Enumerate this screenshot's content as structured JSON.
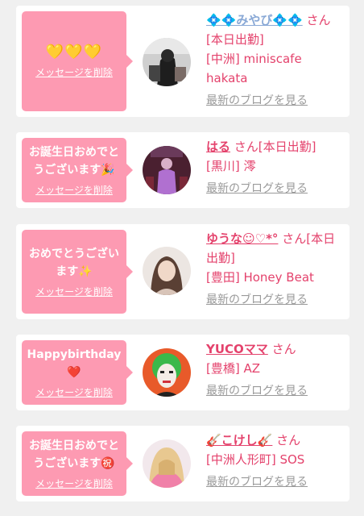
{
  "delete_label": "メッセージを削除",
  "blog_label": "最新のブログを見る",
  "san_suffix": "さん[本日出勤]",
  "san_only": "さん",
  "cards": [
    {
      "message": "💛💛💛",
      "name": "💠💠みやび💠💠",
      "shop": "[中洲] miniscafe hakata",
      "avatar": "avatar-dark-outfit"
    },
    {
      "message": "お誕生日おめでとうございます🎉",
      "name": "はる",
      "shop": "[黒川] 澪",
      "avatar": "avatar-purple-stage"
    },
    {
      "message": "おめでとうございます✨",
      "name": "ゆうな☺︎♡*°",
      "shop": "[豊田] Honey Beat",
      "avatar": "avatar-woman-photo"
    },
    {
      "message": "Happybirthday❤️",
      "name": "YUCOママ",
      "shop": "[豊橋] AZ",
      "avatar": "avatar-green-hair-illustration"
    },
    {
      "message": "お誕生日おめでとうございます㊗️",
      "name": "🎸こけし🎸",
      "shop": "[中洲人形町] SOS",
      "avatar": "avatar-pink-blonde-hair"
    }
  ],
  "colors": {
    "bubble": "#fd9ab2",
    "accent": "#e4426c",
    "muted": "#9a9a9a",
    "background": "#f0f0f0"
  }
}
